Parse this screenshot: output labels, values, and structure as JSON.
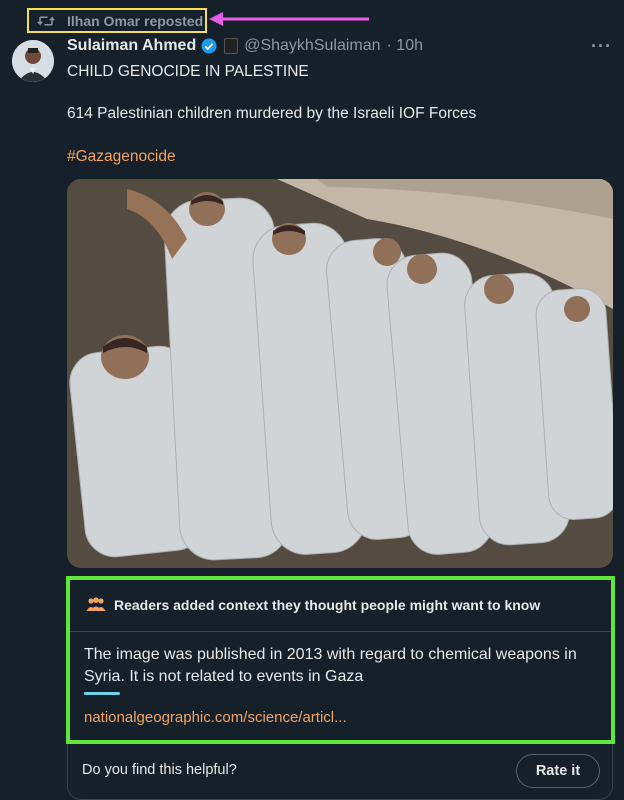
{
  "repost": {
    "label": "Ilhan Omar reposted",
    "icon": "repost-icon",
    "highlight_color": "#f4e04d"
  },
  "annotation": {
    "arrow_color": "#e65ce6"
  },
  "tweet": {
    "display_name": "Sulaiman Ahmed",
    "handle": "@ShaykhSulaiman",
    "time": "· 10h",
    "more_label": "···",
    "line1": "CHILD GENOCIDE IN PALESTINE",
    "line2": "614 Palestinian children murdered by the Israeli IOF Forces",
    "hashtag": "#Gazagenocide"
  },
  "community_note": {
    "header": "Readers added context they thought people might want to know",
    "body": "The image was published in 2013 with regard to chemical weapons in Syria. It is not related to events in Gaza",
    "link": "nationalgeographic.com/science/articl...",
    "border_color": "#62e63d"
  },
  "helpful": {
    "question": "Do you find this helpful?",
    "rate_label": "Rate it"
  },
  "colors": {
    "background": "#15202b",
    "accent_link": "#f4a35c",
    "verified": "#1d9bf0"
  }
}
